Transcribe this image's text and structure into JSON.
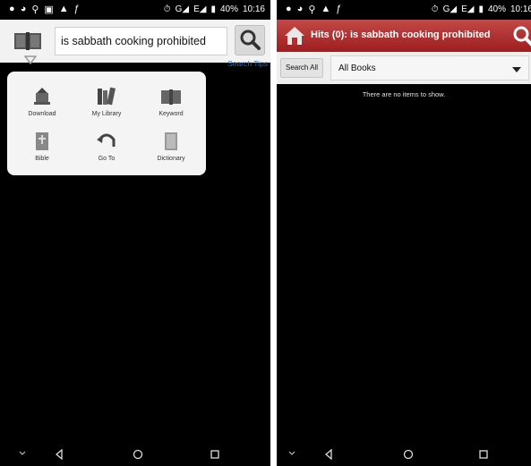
{
  "left": {
    "status": {
      "time": "10:16",
      "battery": "40%"
    },
    "search": {
      "query": "is sabbath cooking prohibited",
      "tips_label": "Search Tips"
    },
    "menu": [
      {
        "label": "Download",
        "icon": "download-icon"
      },
      {
        "label": "My Library",
        "icon": "library-icon"
      },
      {
        "label": "Keyword",
        "icon": "keyword-icon"
      },
      {
        "label": "Bible",
        "icon": "bible-icon"
      },
      {
        "label": "Go To",
        "icon": "go-to-icon"
      },
      {
        "label": "Dictionary",
        "icon": "dictionary-icon"
      }
    ]
  },
  "right": {
    "status": {
      "time": "10:16",
      "battery": "40%"
    },
    "title": "Hits (0): is sabbath cooking prohibited",
    "search_all_label": "Search All",
    "book_filter": "All Books",
    "empty_message": "There are no items to show."
  },
  "colors": {
    "titlebar": "#b03030",
    "link": "#2a6cc2",
    "background": "#000000"
  }
}
